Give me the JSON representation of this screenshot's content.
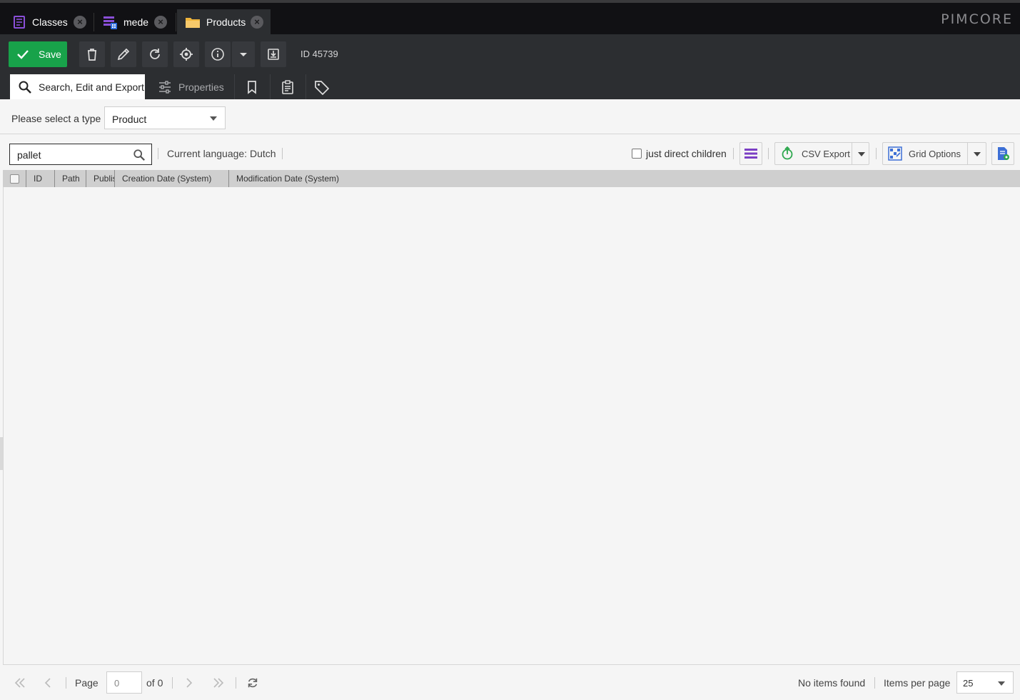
{
  "tabs": [
    {
      "label": "Classes",
      "icon": "classes-icon"
    },
    {
      "label": "mede",
      "icon": "grid-list-icon"
    },
    {
      "label": "Products",
      "icon": "folder-icon"
    }
  ],
  "logo": "PIMCORE",
  "toolbar": {
    "save_label": "Save",
    "id_text": "ID 45739"
  },
  "subtabs": {
    "search": "Search, Edit and Export",
    "properties": "Properties"
  },
  "type_selector": {
    "label": "Please select a type",
    "value": "Product"
  },
  "grid_toolbar": {
    "search_value": "pallet",
    "language": "Current language: Dutch",
    "direct_children_label": "just direct children",
    "csv_export_label": "CSV Export",
    "grid_options_label": "Grid Options"
  },
  "columns": [
    "ID",
    "Path",
    "Publis",
    "Creation Date (System)",
    "Modification Date (System)"
  ],
  "pager": {
    "page_label": "Page",
    "page_value": "0",
    "of_label": "of 0",
    "status": "No items found",
    "items_per_page_label": "Items per page",
    "items_per_page_value": "25"
  },
  "colors": {
    "save_green": "#18a24a",
    "dark_bg": "#2c2e31",
    "tab_bar": "#111114"
  }
}
